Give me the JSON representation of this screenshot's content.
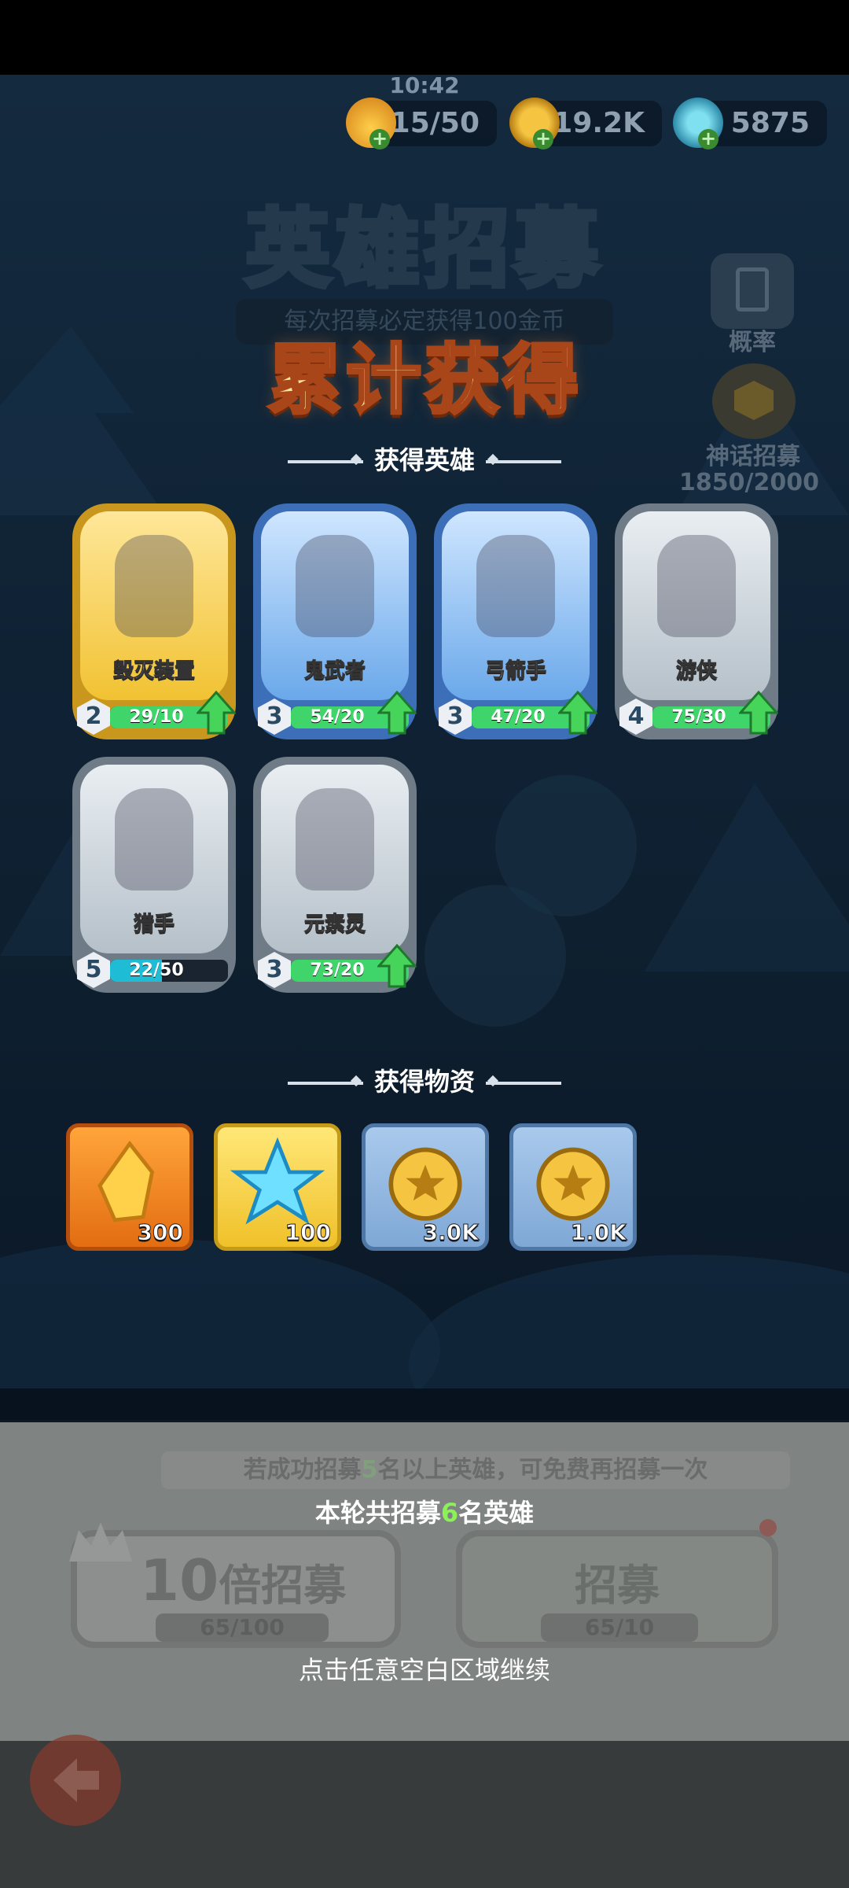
{
  "status": {
    "time": "10:42"
  },
  "currency": [
    {
      "icon": "energy-flame-icon",
      "value": "15/50"
    },
    {
      "icon": "gold-coin-icon",
      "value": "19.2K"
    },
    {
      "icon": "blue-crystal-icon",
      "value": "5875"
    }
  ],
  "background": {
    "title": "英雄招募",
    "subtitle": "每次招募必定获得100金币",
    "probability_label": "概率",
    "mythic_label": "神话招募",
    "mythic_progress": "1850/2000"
  },
  "overlay": {
    "title": "累计获得",
    "heroes_header": "获得英雄",
    "items_header": "获得物资"
  },
  "heroes": [
    {
      "name": "毁灭装置",
      "level": "2",
      "progress": "29/10",
      "ratio": 1.0,
      "upgradable": true,
      "rarity_color": "#f2c63a",
      "icon": "mech-robot-icon"
    },
    {
      "name": "鬼武者",
      "level": "3",
      "progress": "54/20",
      "ratio": 1.0,
      "upgradable": true,
      "rarity_color": "#5f9bdf",
      "icon": "oni-samurai-icon"
    },
    {
      "name": "弓箭手",
      "level": "3",
      "progress": "47/20",
      "ratio": 1.0,
      "upgradable": true,
      "rarity_color": "#5f9bdf",
      "icon": "archer-icon"
    },
    {
      "name": "游侠",
      "level": "4",
      "progress": "75/30",
      "ratio": 1.0,
      "upgradable": true,
      "rarity_color": "#a9b4be",
      "icon": "ranger-icon"
    },
    {
      "name": "猎手",
      "level": "5",
      "progress": "22/50",
      "ratio": 0.44,
      "upgradable": false,
      "rarity_color": "#a9b4be",
      "icon": "hunter-icon"
    },
    {
      "name": "元素灵",
      "level": "3",
      "progress": "73/20",
      "ratio": 1.0,
      "upgradable": true,
      "rarity_color": "#a9b4be",
      "icon": "elemental-spirit-icon"
    }
  ],
  "items": [
    {
      "icon": "gold-crystal-icon",
      "qty": "300",
      "frame": "orange"
    },
    {
      "icon": "ice-crystal-icon",
      "qty": "100",
      "frame": "yellow"
    },
    {
      "icon": "gold-coin-icon",
      "qty": "3.0K",
      "frame": "blue"
    },
    {
      "icon": "gold-coin-icon",
      "qty": "1.0K",
      "frame": "blue"
    }
  ],
  "footer": {
    "note_prefix": "若成功招募",
    "note_number": "5",
    "note_suffix": "名以上英雄，可免费再招募一次",
    "summary_prefix": "本轮共招募",
    "summary_number": "6",
    "summary_suffix": "名英雄",
    "btn_ten_number": "10",
    "btn_ten_label": "倍招募",
    "btn_ten_keys": "65/100",
    "btn_single_label": "招募",
    "btn_single_keys": "65/10",
    "continue_hint": "点击任意空白区域继续"
  },
  "colors": {
    "accent_green": "#8bf05a",
    "progress_green": "#3fd56b",
    "progress_cyan": "#1fbcd6"
  }
}
